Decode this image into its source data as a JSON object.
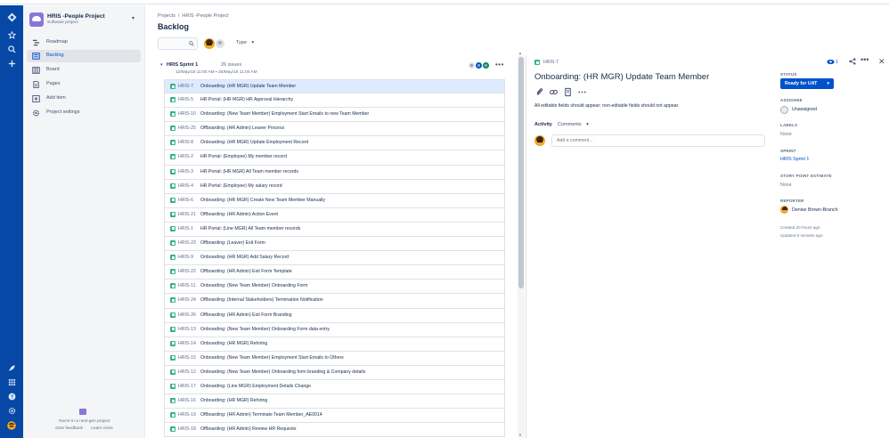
{
  "project": {
    "name": "HRIS -People Project",
    "type": "Software project"
  },
  "sidebar": {
    "items": [
      {
        "label": "Roadmap",
        "icon": "roadmap-icon"
      },
      {
        "label": "Backlog",
        "icon": "backlog-icon",
        "active": true
      },
      {
        "label": "Board",
        "icon": "board-icon"
      },
      {
        "label": "Pages",
        "icon": "pages-icon"
      },
      {
        "label": "Add item",
        "icon": "add-item-icon"
      },
      {
        "label": "Project settings",
        "icon": "settings-icon"
      }
    ],
    "footer": {
      "text": "You're in a next-gen project",
      "give_feedback": "Give feedback",
      "learn_more": "Learn more"
    }
  },
  "breadcrumb": {
    "root": "Projects",
    "separator": "/",
    "project": "HRIS -People Project"
  },
  "page": {
    "title": "Backlog"
  },
  "filters": {
    "type_label": "Type",
    "chevron": "▾"
  },
  "sprint": {
    "toggle": "▾",
    "name": "HRIS Sprint 1",
    "count": "26 issues",
    "dates": "12/May/19 11:00 AM • 26/May/19 11:00 AM",
    "todo_count": "0",
    "in_progress_count": "0",
    "done_count": "0",
    "more": "•••"
  },
  "issues": [
    {
      "key": "HRIS-7",
      "summary": "Onboarding: (HR MGR) Update Team Member"
    },
    {
      "key": "HRIS-5",
      "summary": "HR Portal: (HR MGR) HR Approval Hierarchy"
    },
    {
      "key": "HRIS-10",
      "summary": "Onboarding: (New Team Member) Employment Start Emails to new Team Member"
    },
    {
      "key": "HRIS-25",
      "summary": "Offboarding: (HR Admin) Leaver Process"
    },
    {
      "key": "HRIS-8",
      "summary": "Onboarding: (HR MGR) Update Employment Record"
    },
    {
      "key": "HRIS-2",
      "summary": "HR Portal: (Employee) My member record"
    },
    {
      "key": "HRIS-3",
      "summary": "HR Portal: (HR MGR) All Team member records"
    },
    {
      "key": "HRIS-4",
      "summary": "HR Portal: (Employee) My salary record"
    },
    {
      "key": "HRIS-6",
      "summary": "Onboarding: (HR MGR) Create New Team Member Manually"
    },
    {
      "key": "HRIS-21",
      "summary": "Offboarding: (HR Admin) Action Event"
    },
    {
      "key": "HRIS-1",
      "summary": "HR Portal: (Line MGR) All Team member records"
    },
    {
      "key": "HRIS-23",
      "summary": "Offboarding: (Leaver) Exit Form"
    },
    {
      "key": "HRIS-9",
      "summary": "Onboarding: (HR MGR) Add Salary Record"
    },
    {
      "key": "HRIS-22",
      "summary": "Offboarding: (HR Admin) Exit Form Template"
    },
    {
      "key": "HRIS-11",
      "summary": "Onboarding: (New Team Member) Onboarding Form"
    },
    {
      "key": "HRIS-24",
      "summary": "Offboarding: (Internal Stakeholders) Termination Notification"
    },
    {
      "key": "HRIS-26",
      "summary": "Offboarding: (HR Admin) Exit Form Branding"
    },
    {
      "key": "HRIS-13",
      "summary": "Onboarding: (New Team Member) Onboarding Form data entry"
    },
    {
      "key": "HRIS-14",
      "summary": "Onboarding: (HR MGR) Rehiring"
    },
    {
      "key": "HRIS-15",
      "summary": "Onboarding: (New Team Member) Employment Start Emails to Others"
    },
    {
      "key": "HRIS-12",
      "summary": "Onboarding: (New Team Member) Onboarding form branding & Company details"
    },
    {
      "key": "HRIS-17",
      "summary": "Onboarding: (Line MGR) Employment Details Change"
    },
    {
      "key": "HRIS-16",
      "summary": "Onboarding: (HR MGR) Rehiring"
    },
    {
      "key": "HRIS-19",
      "summary": "Offboarding: (HR Admin) Terminate Team Member_AE0014"
    },
    {
      "key": "HRIS-18",
      "summary": "Offboarding: (HR Admin) Review HR Requests"
    }
  ],
  "detail": {
    "key": "HRIS-7",
    "title": "Onboarding: (HR MGR) Update Team Member",
    "watch_count": "1",
    "description": "All editable fields should appear; non-editable fields should not appear.",
    "activity_label": "Activity",
    "comments_select": "Comments",
    "comment_placeholder": "Add a comment...",
    "more": "•••",
    "close": "✕",
    "fields": {
      "status_label": "STATUS",
      "status_value": "Ready for UAT",
      "assignee_label": "ASSIGNEE",
      "assignee_value": "Unassigned",
      "labels_label": "LABELS",
      "labels_value": "None",
      "sprint_label": "SPRINT",
      "sprint_value": "HRIS Sprint 1",
      "estimate_label": "STORY POINT ESTIMATE",
      "estimate_value": "None",
      "reporter_label": "REPORTER",
      "reporter_value": "Denise Brown-Branch",
      "created": "Created 20 hours ago",
      "updated": "Updated 8 minutes ago"
    }
  },
  "colors": {
    "global_nav": "#0747a6",
    "primary": "#0052cc",
    "story": "#36b37e",
    "selected_row": "#deebff"
  }
}
